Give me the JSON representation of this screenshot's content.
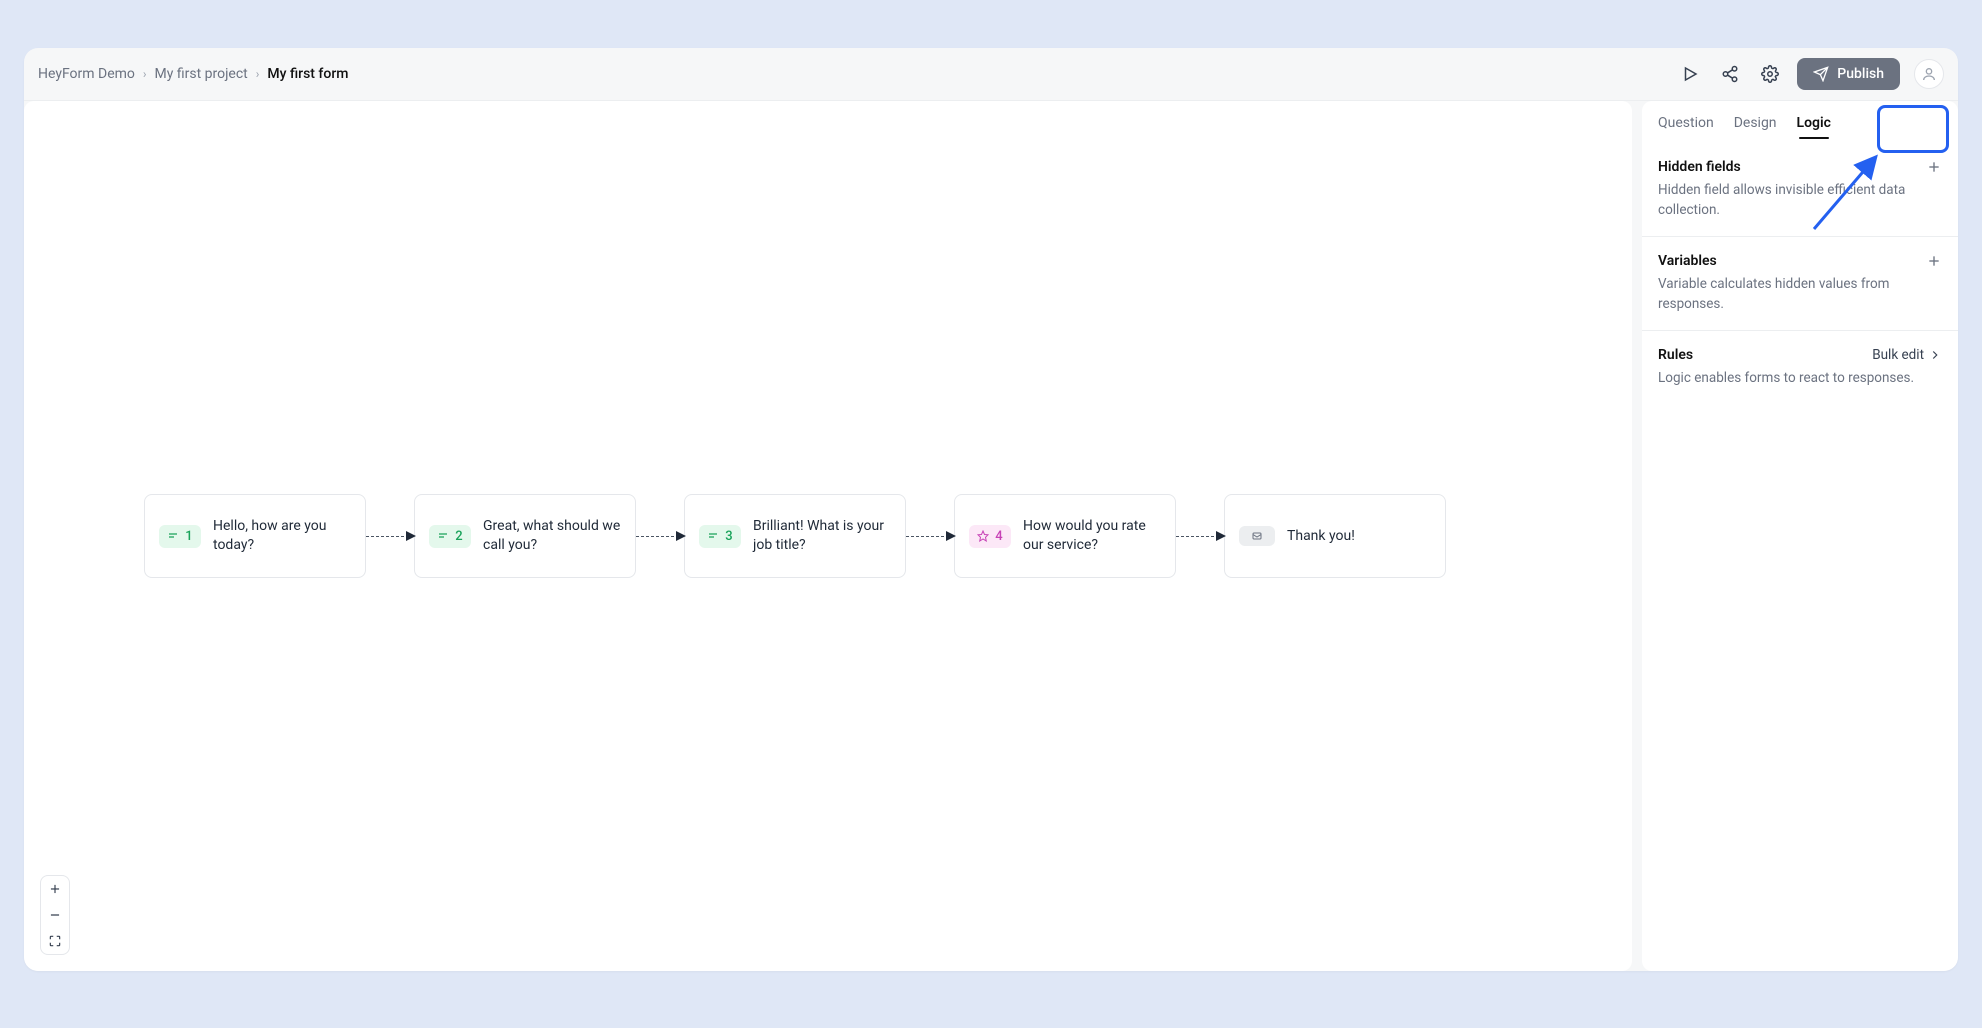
{
  "breadcrumbs": {
    "workspace": "HeyForm Demo",
    "project": "My first project",
    "form": "My first form"
  },
  "header": {
    "publish_label": "Publish"
  },
  "tabs": {
    "question": "Question",
    "design": "Design",
    "logic": "Logic"
  },
  "sidebar": {
    "hidden_fields": {
      "title": "Hidden fields",
      "desc": "Hidden field allows invisible efficient data collection."
    },
    "variables": {
      "title": "Variables",
      "desc": "Variable calculates hidden values from responses."
    },
    "rules": {
      "title": "Rules",
      "bulk_edit": "Bulk edit",
      "desc": "Logic enables forms to react to responses."
    }
  },
  "nodes": [
    {
      "kind": "text",
      "num": "1",
      "label": "Hello, how are you today?"
    },
    {
      "kind": "text",
      "num": "2",
      "label": "Great, what should we call you?"
    },
    {
      "kind": "text",
      "num": "3",
      "label": "Brilliant! What is your job title?"
    },
    {
      "kind": "rating",
      "num": "4",
      "label": "How would you rate our service?"
    },
    {
      "kind": "thank",
      "num": "",
      "label": "Thank you!"
    }
  ]
}
